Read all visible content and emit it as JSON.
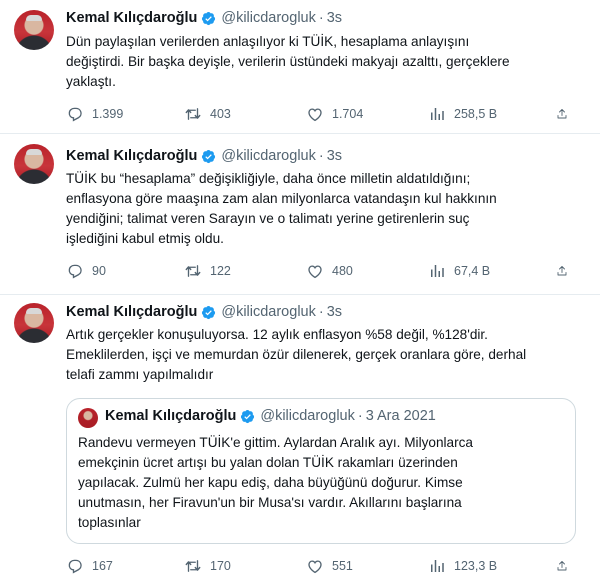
{
  "tweets": [
    {
      "name": "Kemal Kılıçdaroğlu",
      "handle": "@kilicdarogluk",
      "sep": "·",
      "time": "3s",
      "lines": [
        "Dün paylaşılan verilerden anlaşılıyor ki TÜİK, hesaplama anlayışını",
        "değiştirdi. Bir başka deyişle, verilerin üstündeki makyajı azalttı, gerçeklere",
        "yaklaştı."
      ],
      "stats": {
        "replies": "1.399",
        "retweets": "403",
        "likes": "1.704",
        "views": "258,5 B"
      }
    },
    {
      "name": "Kemal Kılıçdaroğlu",
      "handle": "@kilicdarogluk",
      "sep": "·",
      "time": "3s",
      "lines": [
        "TÜİK bu “hesaplama” değişikliğiyle, daha önce milletin aldatıldığını;",
        "enflasyona göre maaşına zam alan milyonlarca vatandaşın kul hakkının",
        "yendiğini; talimat veren Sarayın ve o talimatı yerine getirenlerin suç",
        "işlediğini kabul etmiş oldu."
      ],
      "stats": {
        "replies": "90",
        "retweets": "122",
        "likes": "480",
        "views": "67,4 B"
      }
    },
    {
      "name": "Kemal Kılıçdaroğlu",
      "handle": "@kilicdarogluk",
      "sep": "·",
      "time": "3s",
      "lines": [
        "Artık gerçekler konuşuluyorsa. 12 aylık enflasyon %58 değil, %128'dir.",
        "Emeklilerden, işçi ve memurdan özür dilenerek, gerçek oranlara göre, derhal",
        "telafi zammı yapılmalıdır"
      ],
      "quote": {
        "name": "Kemal Kılıçdaroğlu",
        "handle": "@kilicdarogluk",
        "sep": "·",
        "time": "3 Ara 2021",
        "lines": [
          "Randevu vermeyen TÜİK'e gittim. Aylardan Aralık ayı. Milyonlarca",
          "emekçinin ücret artışı bu yalan dolan TÜİK rakamları üzerinden",
          "yapılacak. Zulmü her kapu ediş, daha büyüğünü doğurur. Kimse",
          "unutmasın, her Firavun'un bir Musa'sı vardır. Akıllarını başlarına",
          "toplasınlar"
        ]
      },
      "stats": {
        "replies": "167",
        "retweets": "170",
        "likes": "551",
        "views": "123,3 B"
      }
    }
  ],
  "colors": {
    "verified": "#1d9bf0",
    "muted": "#536471",
    "text": "#0f1419"
  },
  "icons": [
    "reply-icon",
    "retweet-icon",
    "like-icon",
    "views-icon",
    "share-icon",
    "verified-badge-icon"
  ]
}
